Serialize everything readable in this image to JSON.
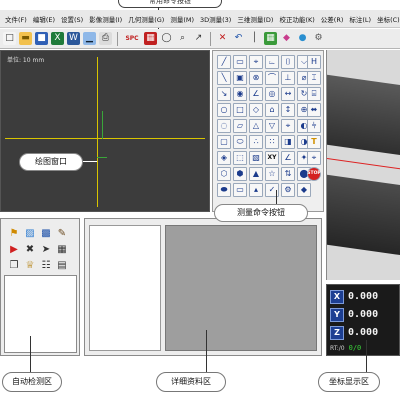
{
  "top_callout": {
    "label": "常用命令按钮"
  },
  "menubar": {
    "items": [
      "文件(F)",
      "编辑(E)",
      "设置(S)",
      "影像测量(I)",
      "几何测量(G)",
      "测量(M)",
      "3D测量(3)",
      "三维测量(D)",
      "校正功能(K)",
      "公差(R)",
      "标注(L)",
      "坐标(C)",
      "选项(O)",
      "帮助(H)"
    ]
  },
  "toolbar": {
    "icons": [
      "new-file-icon",
      "open-folder-icon",
      "save-icon",
      "excel-icon",
      "word-icon",
      "chart-icon",
      "print-icon",
      "spc-icon",
      "measure-tool-icon",
      "lens-icon",
      "zoom-icon",
      "pointer-icon",
      "delete-icon",
      "undo-icon",
      "ruler-icon",
      "grid-icon",
      "pin-icon",
      "color-icon",
      "settings-icon"
    ],
    "spc_label": "SPC"
  },
  "draw_window": {
    "unit_label": "单位: 10 mm",
    "callout": "绘图窗口"
  },
  "measure_panel": {
    "callout": "测量命令按钮",
    "buttons": [
      "╱",
      "▭",
      "⌖",
      "⌳",
      "⌷",
      "⌵",
      "╲",
      "▣",
      "⊗",
      "⌒",
      "⊥",
      "⌀",
      "↘",
      "◉",
      "∠",
      "◎",
      "↔",
      "↻",
      "○",
      "□",
      "◇",
      "⌂",
      "↕",
      "⊕",
      "◌",
      "▱",
      "△",
      "▽",
      "⌖",
      "◐",
      "▢",
      "⬭",
      "∴",
      "∷",
      "◨",
      "◑",
      "◈",
      "⬚",
      "▧",
      "XY",
      "∠",
      "✦",
      "⬡",
      "⬢",
      "▲",
      "☆",
      "⇅",
      "⬤",
      "⬬",
      "▭",
      "▴",
      "✓",
      "⚙",
      "◆"
    ],
    "right_col": [
      "H",
      "⌶",
      "⌸",
      "⬌",
      "⫩",
      "T",
      "⌖",
      "STOP"
    ]
  },
  "auto_panel": {
    "icons": [
      "flag-icon",
      "cube-icon",
      "cubes-icon",
      "brush-icon",
      "flag-red-icon",
      "cross-icon",
      "arrow-right-icon",
      "grid4-icon",
      "copy-icon",
      "trophy-icon",
      "graph-icon",
      "grid-icon"
    ]
  },
  "coord_panel": {
    "rows": [
      {
        "axis": "X",
        "value": "0.000"
      },
      {
        "axis": "Y",
        "value": "0.000"
      },
      {
        "axis": "Z",
        "value": "0.000"
      }
    ],
    "status_left": "RT:/0",
    "status_right": "0/0"
  },
  "labels": {
    "auto": "自动检测区",
    "detail": "详细资料区",
    "coord": "坐标显示区"
  }
}
